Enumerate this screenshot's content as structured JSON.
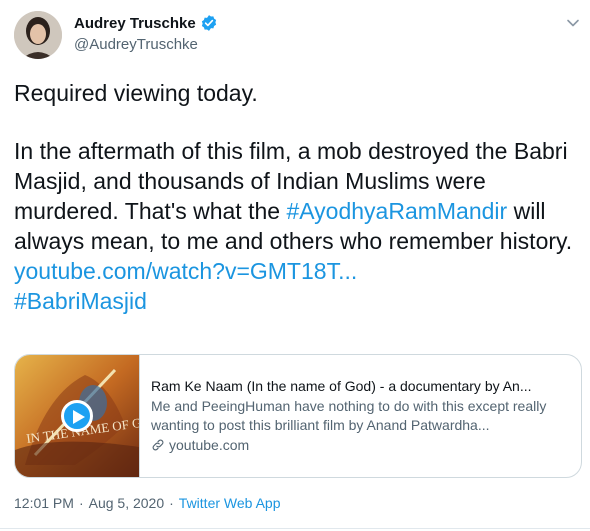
{
  "author": {
    "name": "Audrey Truschke",
    "handle": "@AudreyTruschke"
  },
  "tweet": {
    "line1": "Required viewing today.",
    "para2_part1": "In the aftermath of this film, a mob destroyed the Babri Masjid, and thousands of Indian Muslims were murdered. That's what the ",
    "hashtag1": "#AyodhyaRamMandir",
    "para2_part2": " will always mean, to me and others who remember history.",
    "url": "youtube.com/watch?v=GMT18T...",
    "hashtag2": "#BabriMasjid"
  },
  "card": {
    "title": "Ram Ke Naam (In the name of God) - a documentary by An...",
    "description": "Me and PeeingHuman have nothing to do with this except really wanting to post this brilliant film by Anand Patwardha...",
    "domain": "youtube.com",
    "thumbnail_text": "IN THE NAME OF GOD"
  },
  "meta": {
    "time": "12:01 PM",
    "separator": "·",
    "date": "Aug 5, 2020",
    "source": "Twitter Web App"
  },
  "colors": {
    "link": "#1b95e0",
    "verified": "#1da1f2",
    "secondary_text": "#536471"
  }
}
